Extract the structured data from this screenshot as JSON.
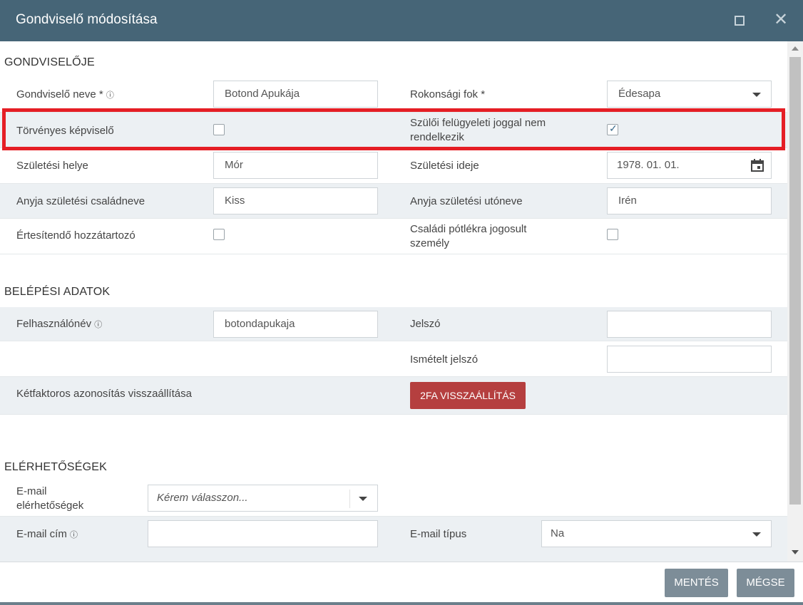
{
  "window": {
    "title": "Gondviselő módosítása",
    "maximize_icon": "maximize-icon",
    "close_icon": "close-icon",
    "close_glyph": "✕"
  },
  "sections": {
    "guardian": "GONDVISELŐJE",
    "login": "BELÉPÉSI ADATOK",
    "contacts": "ELÉRHETŐSÉGEK"
  },
  "guardian": {
    "name_label": "Gondviselő neve *",
    "name_value": "Botond Apukája",
    "relation_label": "Rokonsági fok *",
    "relation_value": "Édesapa",
    "legal_rep_label": "Törvényes képviselő",
    "legal_rep_checked": false,
    "no_custody_label": "Szülői felügyeleti joggal nem rendelkezik",
    "no_custody_checked": true,
    "birthplace_label": "Születési helye",
    "birthplace_value": "Mór",
    "birthdate_label": "Születési ideje",
    "birthdate_value": "1978. 01. 01.",
    "mother_last_label": "Anyja születési családneve",
    "mother_last_value": "Kiss",
    "mother_first_label": "Anyja születési utóneve",
    "mother_first_value": "Irén",
    "notify_label": "Értesítendő hozzátartozó",
    "notify_checked": false,
    "family_allowance_label": "Családi pótlékra jogosult személy",
    "family_allowance_checked": false
  },
  "login": {
    "username_label": "Felhasználónév",
    "username_value": "botondapukaja",
    "password_label": "Jelszó",
    "password_value": "",
    "password_repeat_label": "Ismételt jelszó",
    "password_repeat_value": "",
    "twofa_label": "Kétfaktoros azonosítás visszaállítása",
    "twofa_button": "2FA VISSZAÁLLÍTÁS"
  },
  "contacts": {
    "email_contacts_label": "E-mail elérhetőségek",
    "email_contacts_placeholder": "Kérem válasszon...",
    "email_label": "E-mail cím",
    "email_value": "",
    "email_type_label": "E-mail típus",
    "email_type_value": "Na"
  },
  "footer": {
    "save": "MENTÉS",
    "cancel": "MÉGSE"
  },
  "info_glyph": "ⓘ",
  "check_glyph": "✓",
  "colors": {
    "titlebar": "#466577",
    "danger_button": "#b53f3f",
    "highlight": "#e51e25",
    "footer_button": "#7d8d98"
  }
}
